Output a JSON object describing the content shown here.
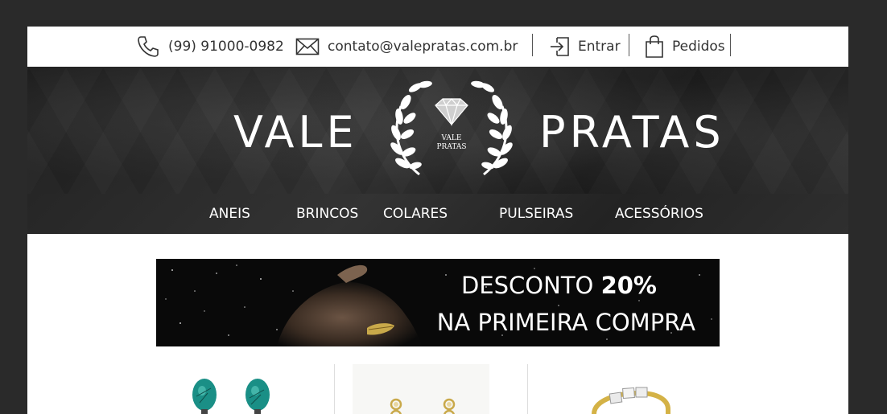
{
  "topbar": {
    "phone": "(99) 91000-0982",
    "email": "contato@valepratas.com.br",
    "login_label": "Entrar",
    "orders_label": "Pedidos"
  },
  "brand": {
    "left_word": "VALE",
    "right_word": "PRATAS",
    "emblem_line1": "VALE",
    "emblem_line2": "PRATAS"
  },
  "nav": {
    "items": [
      {
        "label": "ANEIS"
      },
      {
        "label": "BRINCOS"
      },
      {
        "label": "COLARES"
      },
      {
        "label": "PULSEIRAS"
      },
      {
        "label": "ACESSÓRIOS"
      }
    ]
  },
  "banner": {
    "line1_prefix": "DESCONTO",
    "line1_value": "20%",
    "line2": "NA PRIMEIRA COMPRA"
  },
  "colors": {
    "page_bg": "#2a2a2a",
    "header_bg": "#2b2b2b",
    "text_light": "#ffffff",
    "text_dark": "#333333",
    "turquoise": "#1a8f86",
    "gold": "#c9a94a"
  },
  "icons": {
    "phone": "phone-icon",
    "email": "envelope-icon",
    "login": "sign-in-icon",
    "orders": "shopping-bag-icon",
    "logo": "diamond-laurel-icon"
  }
}
